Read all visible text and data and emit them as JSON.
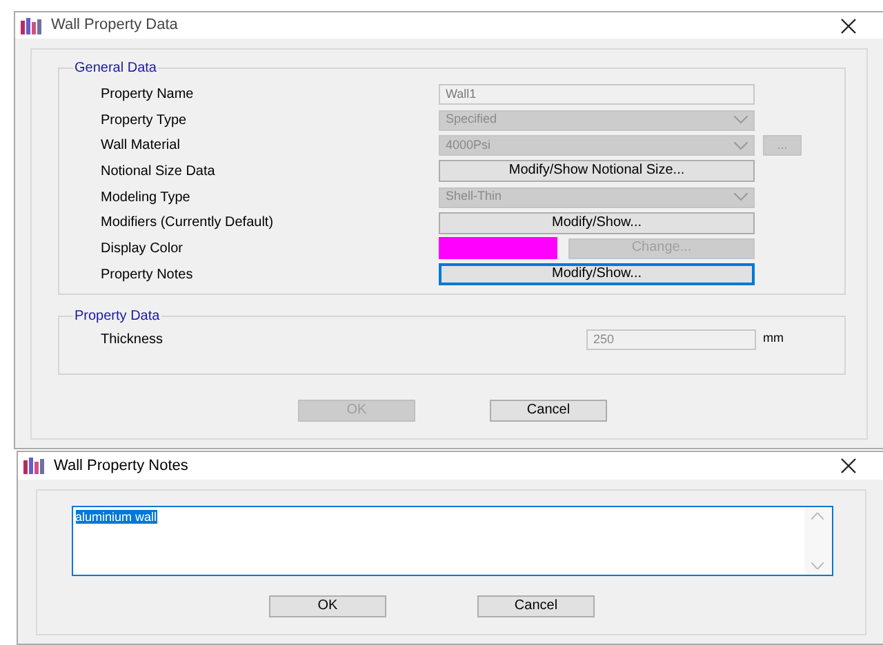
{
  "main_dialog": {
    "title": "Wall Property Data",
    "general_data": {
      "title": "General Data",
      "rows": [
        {
          "label": "Property Name",
          "kind": "text",
          "value": "Wall1",
          "disabled": true
        },
        {
          "label": "Property Type",
          "kind": "dropdown",
          "value": "Specified",
          "disabled": true
        },
        {
          "label": "Wall Material",
          "kind": "dropdown_more",
          "value": "4000Psi",
          "disabled": true,
          "more": "...",
          "more_disabled": true
        },
        {
          "label": "Notional Size Data",
          "kind": "button",
          "value": "Modify/Show Notional Size...",
          "disabled": false,
          "focused": false
        },
        {
          "label": "Modeling Type",
          "kind": "dropdown",
          "value": "Shell-Thin",
          "disabled": true
        },
        {
          "label": "Modifiers (Currently Default)",
          "kind": "button",
          "value": "Modify/Show...",
          "disabled": false,
          "focused": false
        },
        {
          "label": "Display Color",
          "kind": "color",
          "color": "#ff00ff",
          "value": "Change...",
          "disabled": true
        },
        {
          "label": "Property Notes",
          "kind": "button",
          "value": "Modify/Show...",
          "disabled": false,
          "focused": true
        }
      ]
    },
    "property_data": {
      "title": "Property Data",
      "thickness": {
        "label": "Thickness",
        "value": "250",
        "unit": "mm",
        "disabled": true
      }
    },
    "buttons": [
      {
        "label": "OK",
        "disabled": true
      },
      {
        "label": "Cancel",
        "disabled": false
      }
    ]
  },
  "notes_dialog": {
    "title": "Wall Property Notes",
    "notes": {
      "value": "aluminium wall",
      "selected": true
    },
    "buttons": [
      {
        "label": "OK",
        "disabled": false
      },
      {
        "label": "Cancel",
        "disabled": false
      }
    ]
  }
}
